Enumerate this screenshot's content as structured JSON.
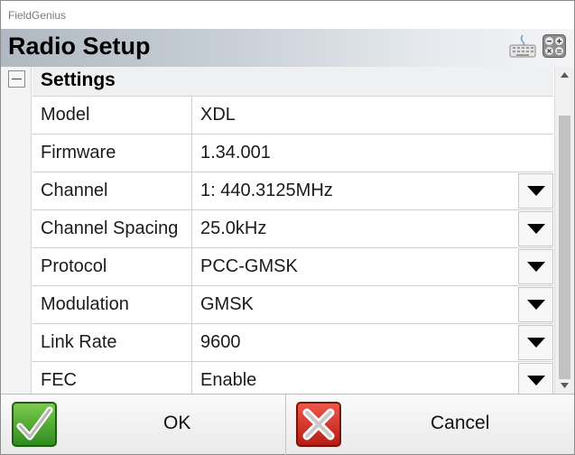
{
  "window": {
    "title": "FieldGenius"
  },
  "header": {
    "title": "Radio Setup",
    "keyboard_icon": "keyboard-icon",
    "calculator_icon": "calculator-icon"
  },
  "section": {
    "title": "Settings",
    "expander_icon": "collapse-minus-icon"
  },
  "rows": [
    {
      "label": "Model",
      "value": "XDL",
      "dropdown": false
    },
    {
      "label": "Firmware",
      "value": "1.34.001",
      "dropdown": false
    },
    {
      "label": "Channel",
      "value": "1: 440.3125MHz",
      "dropdown": true
    },
    {
      "label": "Channel Spacing",
      "value": "25.0kHz",
      "dropdown": true
    },
    {
      "label": "Protocol",
      "value": "PCC-GMSK",
      "dropdown": true
    },
    {
      "label": "Modulation",
      "value": "GMSK",
      "dropdown": true
    },
    {
      "label": "Link Rate",
      "value": "9600",
      "dropdown": true
    },
    {
      "label": "FEC",
      "value": "Enable",
      "dropdown": true
    }
  ],
  "footer": {
    "ok_label": "OK",
    "cancel_label": "Cancel",
    "ok_icon": "green-check-icon",
    "cancel_icon": "red-x-icon"
  },
  "colors": {
    "ok_green": "#3d9b2a",
    "cancel_red": "#d42a20",
    "header_gradient_start": "#b0b8c1"
  }
}
